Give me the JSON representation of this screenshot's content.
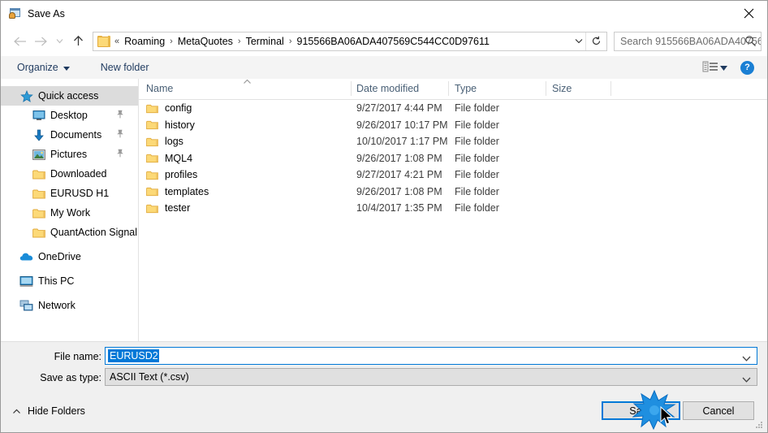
{
  "window": {
    "title": "Save As",
    "icon": "save-as-app-icon",
    "close_icon": "close-icon"
  },
  "nav": {
    "back_icon": "back-arrow-icon",
    "forward_icon": "forward-arrow-icon",
    "recent_icon": "chevron-down-icon",
    "up_icon": "up-arrow-icon",
    "folder_icon": "folder-icon",
    "overflow": "«",
    "breadcrumbs": [
      "Roaming",
      "MetaQuotes",
      "Terminal",
      "915566BA06ADA407569C544CC0D97611"
    ],
    "separator": "›",
    "dropdown_icon": "chevron-down-icon",
    "refresh_icon": "refresh-icon"
  },
  "search": {
    "placeholder": "Search 915566BA06ADA40756...",
    "icon": "search-icon"
  },
  "toolbar": {
    "organize_label": "Organize",
    "organize_caret": "caret-down-icon",
    "new_folder_label": "New folder",
    "view_icon": "view-layout-icon",
    "view_caret": "caret-down-icon",
    "help_label": "?",
    "help_icon": "help-icon"
  },
  "sidebar": {
    "items": [
      {
        "label": "Quick access",
        "icon": "quick-access-star-icon",
        "level": 0,
        "selected": true,
        "pinned": false
      },
      {
        "label": "Desktop",
        "icon": "desktop-monitor-icon",
        "level": 1,
        "selected": false,
        "pinned": true
      },
      {
        "label": "Documents",
        "icon": "documents-download-arrow-icon",
        "level": 1,
        "selected": false,
        "pinned": true
      },
      {
        "label": "Pictures",
        "icon": "pictures-image-icon",
        "level": 1,
        "selected": false,
        "pinned": true
      },
      {
        "label": "Downloaded",
        "icon": "folder-icon",
        "level": 1,
        "selected": false,
        "pinned": false
      },
      {
        "label": "EURUSD H1",
        "icon": "folder-icon",
        "level": 1,
        "selected": false,
        "pinned": false
      },
      {
        "label": "My Work",
        "icon": "folder-icon",
        "level": 1,
        "selected": false,
        "pinned": false
      },
      {
        "label": "QuantAction Signal",
        "icon": "folder-icon",
        "level": 1,
        "selected": false,
        "pinned": false
      },
      {
        "label": "OneDrive",
        "icon": "onedrive-cloud-icon",
        "level": 0,
        "selected": false,
        "pinned": false
      },
      {
        "label": "This PC",
        "icon": "this-pc-monitor-icon",
        "level": 0,
        "selected": false,
        "pinned": false
      },
      {
        "label": "Network",
        "icon": "network-icon",
        "level": 0,
        "selected": false,
        "pinned": false
      }
    ]
  },
  "filelist": {
    "columns": [
      "Name",
      "Date modified",
      "Type",
      "Size"
    ],
    "sort_column": "Name",
    "sort_direction": "ascending",
    "rows": [
      {
        "name": "config",
        "date": "9/27/2017 4:44 PM",
        "type": "File folder",
        "size": "",
        "icon": "folder-icon"
      },
      {
        "name": "history",
        "date": "9/26/2017 10:17 PM",
        "type": "File folder",
        "size": "",
        "icon": "folder-icon"
      },
      {
        "name": "logs",
        "date": "10/10/2017 1:17 PM",
        "type": "File folder",
        "size": "",
        "icon": "folder-icon"
      },
      {
        "name": "MQL4",
        "date": "9/26/2017 1:08 PM",
        "type": "File folder",
        "size": "",
        "icon": "folder-icon"
      },
      {
        "name": "profiles",
        "date": "9/27/2017 4:21 PM",
        "type": "File folder",
        "size": "",
        "icon": "folder-icon"
      },
      {
        "name": "templates",
        "date": "9/26/2017 1:08 PM",
        "type": "File folder",
        "size": "",
        "icon": "folder-icon"
      },
      {
        "name": "tester",
        "date": "10/4/2017 1:35 PM",
        "type": "File folder",
        "size": "",
        "icon": "folder-icon"
      }
    ]
  },
  "form": {
    "filename_label": "File name:",
    "filename_value": "EURUSD2",
    "filename_selected": true,
    "filetype_label": "Save as type:",
    "filetype_value": "ASCII Text (*.csv)",
    "caret_icon": "chevron-down-icon"
  },
  "footer": {
    "hide_folders_label": "Hide Folders",
    "hide_folders_icon": "caret-up-icon",
    "save_label": "Save",
    "cancel_label": "Cancel",
    "resize_grip_icon": "resize-grip-icon",
    "cursor_icon": "mouse-pointer-icon",
    "click_effect_icon": "click-burst-icon"
  },
  "colors": {
    "accent": "#0078d7",
    "selection": "#0078d7",
    "header_text": "#4a6076",
    "folder": "#fcd977",
    "help_blue": "#1a7fd4"
  }
}
